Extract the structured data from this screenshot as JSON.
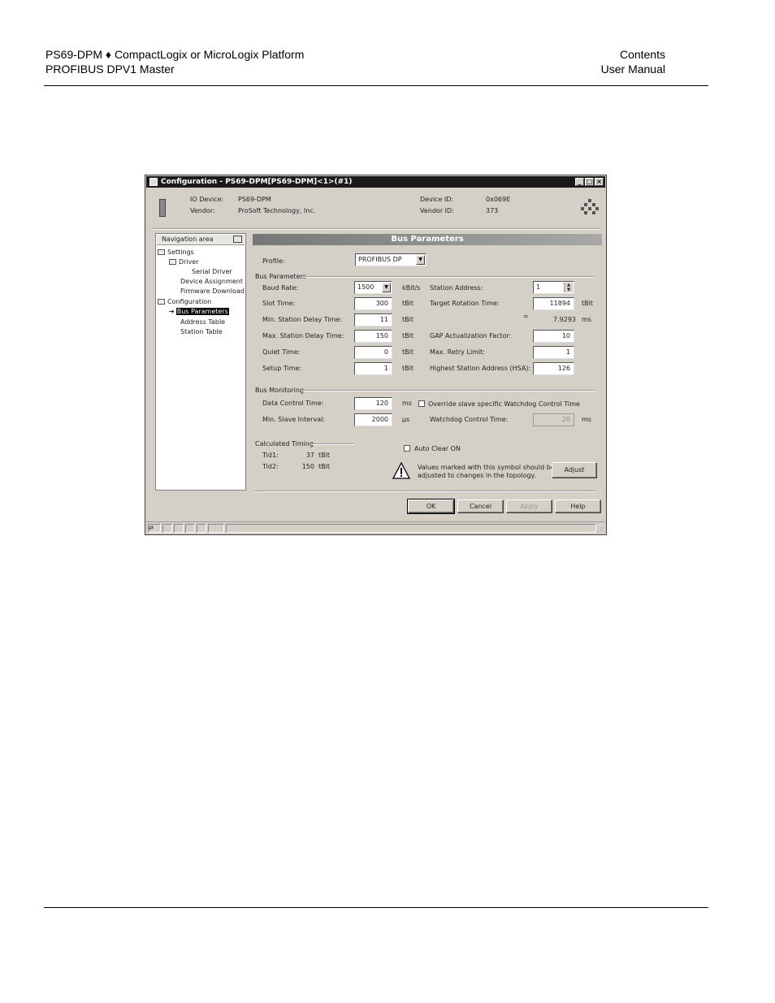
{
  "header": {
    "line1_left": "PS69-DPM ♦ CompactLogix or MicroLogix Platform",
    "line2_left": "PROFIBUS DPV1 Master",
    "line1_right": "Contents",
    "line2_right": "User Manual"
  },
  "window": {
    "title": "Configuration - PS69-DPM[PS69-DPM]<1>(#1)",
    "min": "_",
    "max": "□",
    "close": "×",
    "device": {
      "io_device_label": "IO Device:",
      "io_device_value": "PS69-DPM",
      "vendor_label": "Vendor:",
      "vendor_value": "ProSoft Technology, Inc.",
      "device_id_label": "Device ID:",
      "device_id_value": "0x069E",
      "vendor_id_label": "Vendor ID:",
      "vendor_id_value": "373"
    },
    "nav": {
      "header": "Navigation area",
      "items": [
        "Settings",
        "Driver",
        "Serial Driver",
        "Device Assignment",
        "Firmware Download",
        "Configuration",
        "Bus Parameters",
        "Address Table",
        "Station Table"
      ]
    },
    "panel_title": "Bus Parameters",
    "profile_label": "Profile:",
    "profile_value": "PROFIBUS DP",
    "group_bus_params": "Bus Parameters",
    "left_params": [
      {
        "label": "Baud Rate:",
        "value": "1500",
        "unit": "kBit/s"
      },
      {
        "label": "Slot Time:",
        "value": "300",
        "unit": "tBit"
      },
      {
        "label": "Min. Station Delay Time:",
        "value": "11",
        "unit": "tBit"
      },
      {
        "label": "Max. Station Delay Time:",
        "value": "150",
        "unit": "tBit"
      },
      {
        "label": "Quiet Time:",
        "value": "0",
        "unit": "tBit"
      },
      {
        "label": "Setup Time:",
        "value": "1",
        "unit": "tBit"
      }
    ],
    "right_params": {
      "station_address_label": "Station Address:",
      "station_address_value": "1",
      "target_rotation_label": "Target Rotation Time:",
      "target_rotation_value": "11894",
      "target_rotation_unit": "tBit",
      "dash": "=",
      "target_ms_value": "7.9293",
      "target_ms_unit": "ms",
      "gap_label": "GAP Actualization Factor:",
      "gap_value": "10",
      "retry_label": "Max. Retry Limit:",
      "retry_value": "1",
      "hsa_label": "Highest Station Address (HSA):",
      "hsa_value": "126"
    },
    "group_bus_monitoring": "Bus Monitoring",
    "data_control_label": "Data Control Time:",
    "data_control_value": "120",
    "data_control_unit": "ms",
    "override_label": "Override slave specific Watchdog Control Time",
    "min_slave_label": "Min. Slave Interval:",
    "min_slave_value": "2000",
    "min_slave_unit": "µs",
    "watchdog_label": "Watchdog Control Time:",
    "watchdog_value": "20",
    "watchdog_unit": "ms",
    "group_calc": "Calculated Timing",
    "tid1_label": "Tid1:",
    "tid1_value": "37",
    "tid1_unit": "tBit",
    "tid2_label": "Tid2:",
    "tid2_value": "150",
    "tid2_unit": "tBit",
    "auto_clear_label": "Auto Clear ON",
    "warning_text_1": "Values marked with this symbol should be",
    "warning_text_2": "adjusted to changes in the topology.",
    "adjust_button": "Adjust",
    "ok_button": "OK",
    "cancel_button": "Cancel",
    "apply_button": "Apply",
    "help_button": "Help"
  }
}
